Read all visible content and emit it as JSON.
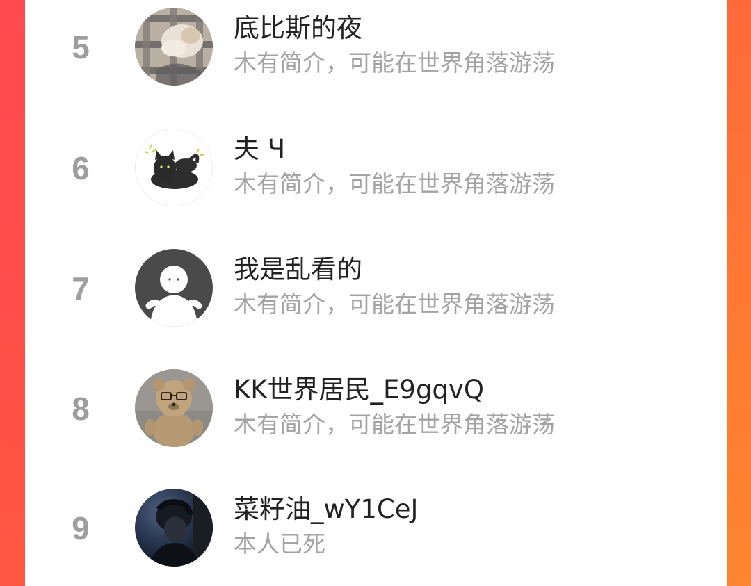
{
  "colors": {
    "accent_left": "#ff4a4f",
    "accent_right": "#ff7a33",
    "rank_text": "#9e9e9e",
    "name_text": "#222222",
    "bio_text": "#a3a3a3"
  },
  "ranking": {
    "items": [
      {
        "rank": "5",
        "name": "底比斯的夜",
        "bio": "木有简介，可能在世界角落游荡",
        "avatar_icon": "plaid-blanket-cat-avatar-icon"
      },
      {
        "rank": "6",
        "name": "夫 Ч",
        "bio": "木有简介，可能在世界角落游荡",
        "avatar_icon": "black-cat-avatar-icon"
      },
      {
        "rank": "7",
        "name": "我是乱看的",
        "bio": "木有简介，可能在世界角落游荡",
        "avatar_icon": "default-person-avatar-icon"
      },
      {
        "rank": "8",
        "name": "KK世界居民_E9gqvQ",
        "bio": "木有简介，可能在世界角落游荡",
        "avatar_icon": "teddy-bear-avatar-icon"
      },
      {
        "rank": "9",
        "name": "菜籽油_wY1CeJ",
        "bio": "本人已死",
        "avatar_icon": "dark-portrait-avatar-icon"
      }
    ]
  }
}
